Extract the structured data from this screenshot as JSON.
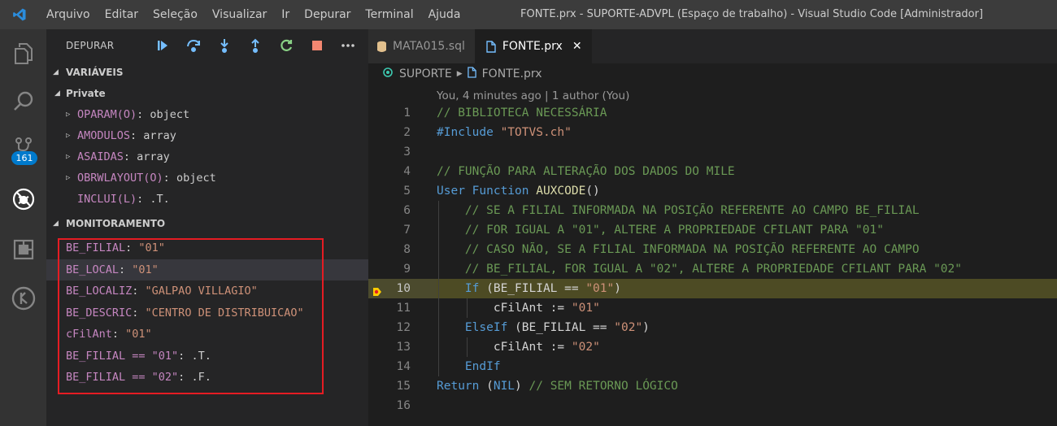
{
  "titlebar": {
    "menu": [
      "Arquivo",
      "Editar",
      "Seleção",
      "Visualizar",
      "Ir",
      "Depurar",
      "Terminal",
      "Ajuda"
    ],
    "window_title": "FONTE.prx - SUPORTE-ADVPL (Espaço de trabalho) - Visual Studio Code [Administrador]"
  },
  "activitybar": {
    "icons": [
      "explorer-icon",
      "search-icon",
      "source-control-icon",
      "debug-icon",
      "extensions-icon",
      "remote-icon"
    ],
    "source_control_badge": "161"
  },
  "sidebar": {
    "debug_label": "DEPURAR",
    "toolbar_icons": [
      "continue-icon",
      "step-over-icon",
      "step-into-icon",
      "step-out-icon",
      "restart-icon",
      "stop-icon",
      "more-icon"
    ],
    "variables_title": "VARIÁVEIS",
    "scope_name": "Private",
    "variables": [
      {
        "name": "OPARAM(O)",
        "value": "object",
        "expandable": true
      },
      {
        "name": "AMODULOS",
        "value": "array",
        "expandable": true
      },
      {
        "name": "ASAIDAS",
        "value": "array",
        "expandable": true
      },
      {
        "name": "OBRWLAYOUT(O)",
        "value": "object",
        "expandable": true
      },
      {
        "name": "INCLUI(L)",
        "value": ".T.",
        "expandable": false
      }
    ],
    "watch_title": "MONITORAMENTO",
    "watch": [
      {
        "name": "BE_FILIAL",
        "value": "\"01\""
      },
      {
        "name": "BE_LOCAL",
        "value": "\"01\""
      },
      {
        "name": "BE_LOCALIZ",
        "value": "\"GALPAO VILLAGIO\""
      },
      {
        "name": "BE_DESCRIC",
        "value": "\"CENTRO DE DISTRIBUICAO\""
      },
      {
        "name": "cFilAnt",
        "value": "\"01\""
      },
      {
        "name": "BE_FILIAL == \"01\"",
        "value": ".T."
      },
      {
        "name": "BE_FILIAL == \"02\"",
        "value": ".F."
      }
    ]
  },
  "editor": {
    "tabs": [
      {
        "label": "MATA015.sql",
        "active": false
      },
      {
        "label": "FONTE.prx",
        "active": true,
        "close": "✕"
      }
    ],
    "breadcrumb": [
      "SUPORTE",
      "FONTE.prx"
    ],
    "codelens": "You, 4 minutes ago | 1 author (You)",
    "current_line": "10",
    "lines": [
      {
        "n": "1",
        "tokens": [
          {
            "t": "// BIBLIOTECA NECESSÁRIA",
            "c": "c-comment"
          }
        ]
      },
      {
        "n": "2",
        "tokens": [
          {
            "t": "#Include ",
            "c": "c-kw"
          },
          {
            "t": "\"TOTVS.ch\"",
            "c": "c-str"
          }
        ]
      },
      {
        "n": "3",
        "tokens": []
      },
      {
        "n": "4",
        "tokens": [
          {
            "t": "// FUNÇÃO PARA ALTERAÇÃO DOS DADOS DO MILE",
            "c": "c-comment"
          }
        ]
      },
      {
        "n": "5",
        "tokens": [
          {
            "t": "User Function ",
            "c": "c-kw"
          },
          {
            "t": "AUXCODE",
            "c": "c-fn"
          },
          {
            "t": "()",
            "c": "c-txt"
          }
        ]
      },
      {
        "n": "6",
        "tokens": [
          {
            "t": "    // SE A FILIAL INFORMADA NA POSIÇÃO REFERENTE AO CAMPO BE_FILIAL",
            "c": "c-comment"
          }
        ]
      },
      {
        "n": "7",
        "tokens": [
          {
            "t": "    // FOR IGUAL A \"01\", ALTERE A PROPRIEDADE CFILANT PARA \"01\"",
            "c": "c-comment"
          }
        ]
      },
      {
        "n": "8",
        "tokens": [
          {
            "t": "    // CASO NÃO, SE A FILIAL INFORMADA NA POSIÇÃO REFERENTE AO CAMPO",
            "c": "c-comment"
          }
        ]
      },
      {
        "n": "9",
        "tokens": [
          {
            "t": "    // BE_FILIAL, FOR IGUAL A \"02\", ALTERE A PROPRIEDADE CFILANT PARA \"02\"",
            "c": "c-comment"
          }
        ]
      },
      {
        "n": "10",
        "tokens": [
          {
            "t": "    If ",
            "c": "c-kw"
          },
          {
            "t": "(BE_FILIAL == ",
            "c": "c-txt"
          },
          {
            "t": "\"01\"",
            "c": "c-str"
          },
          {
            "t": ")",
            "c": "c-txt"
          }
        ]
      },
      {
        "n": "11",
        "tokens": [
          {
            "t": "        cFilAnt := ",
            "c": "c-txt"
          },
          {
            "t": "\"01\"",
            "c": "c-str"
          }
        ]
      },
      {
        "n": "12",
        "tokens": [
          {
            "t": "    ElseIf ",
            "c": "c-kw"
          },
          {
            "t": "(BE_FILIAL == ",
            "c": "c-txt"
          },
          {
            "t": "\"02\"",
            "c": "c-str"
          },
          {
            "t": ")",
            "c": "c-txt"
          }
        ]
      },
      {
        "n": "13",
        "tokens": [
          {
            "t": "        cFilAnt := ",
            "c": "c-txt"
          },
          {
            "t": "\"02\"",
            "c": "c-str"
          }
        ]
      },
      {
        "n": "14",
        "tokens": [
          {
            "t": "    EndIf",
            "c": "c-kw"
          }
        ]
      },
      {
        "n": "15",
        "tokens": [
          {
            "t": "Return ",
            "c": "c-kw"
          },
          {
            "t": "(",
            "c": "c-txt"
          },
          {
            "t": "NIL",
            "c": "c-kw"
          },
          {
            "t": ") ",
            "c": "c-txt"
          },
          {
            "t": "// SEM RETORNO LÓGICO",
            "c": "c-comment"
          }
        ]
      },
      {
        "n": "16",
        "tokens": []
      }
    ]
  },
  "colors": {
    "accent": "#007acc",
    "watch_highlight_border": "#e51c23",
    "current_line_bg": "#4d4b24",
    "breakpoint": "#ffcc00"
  }
}
